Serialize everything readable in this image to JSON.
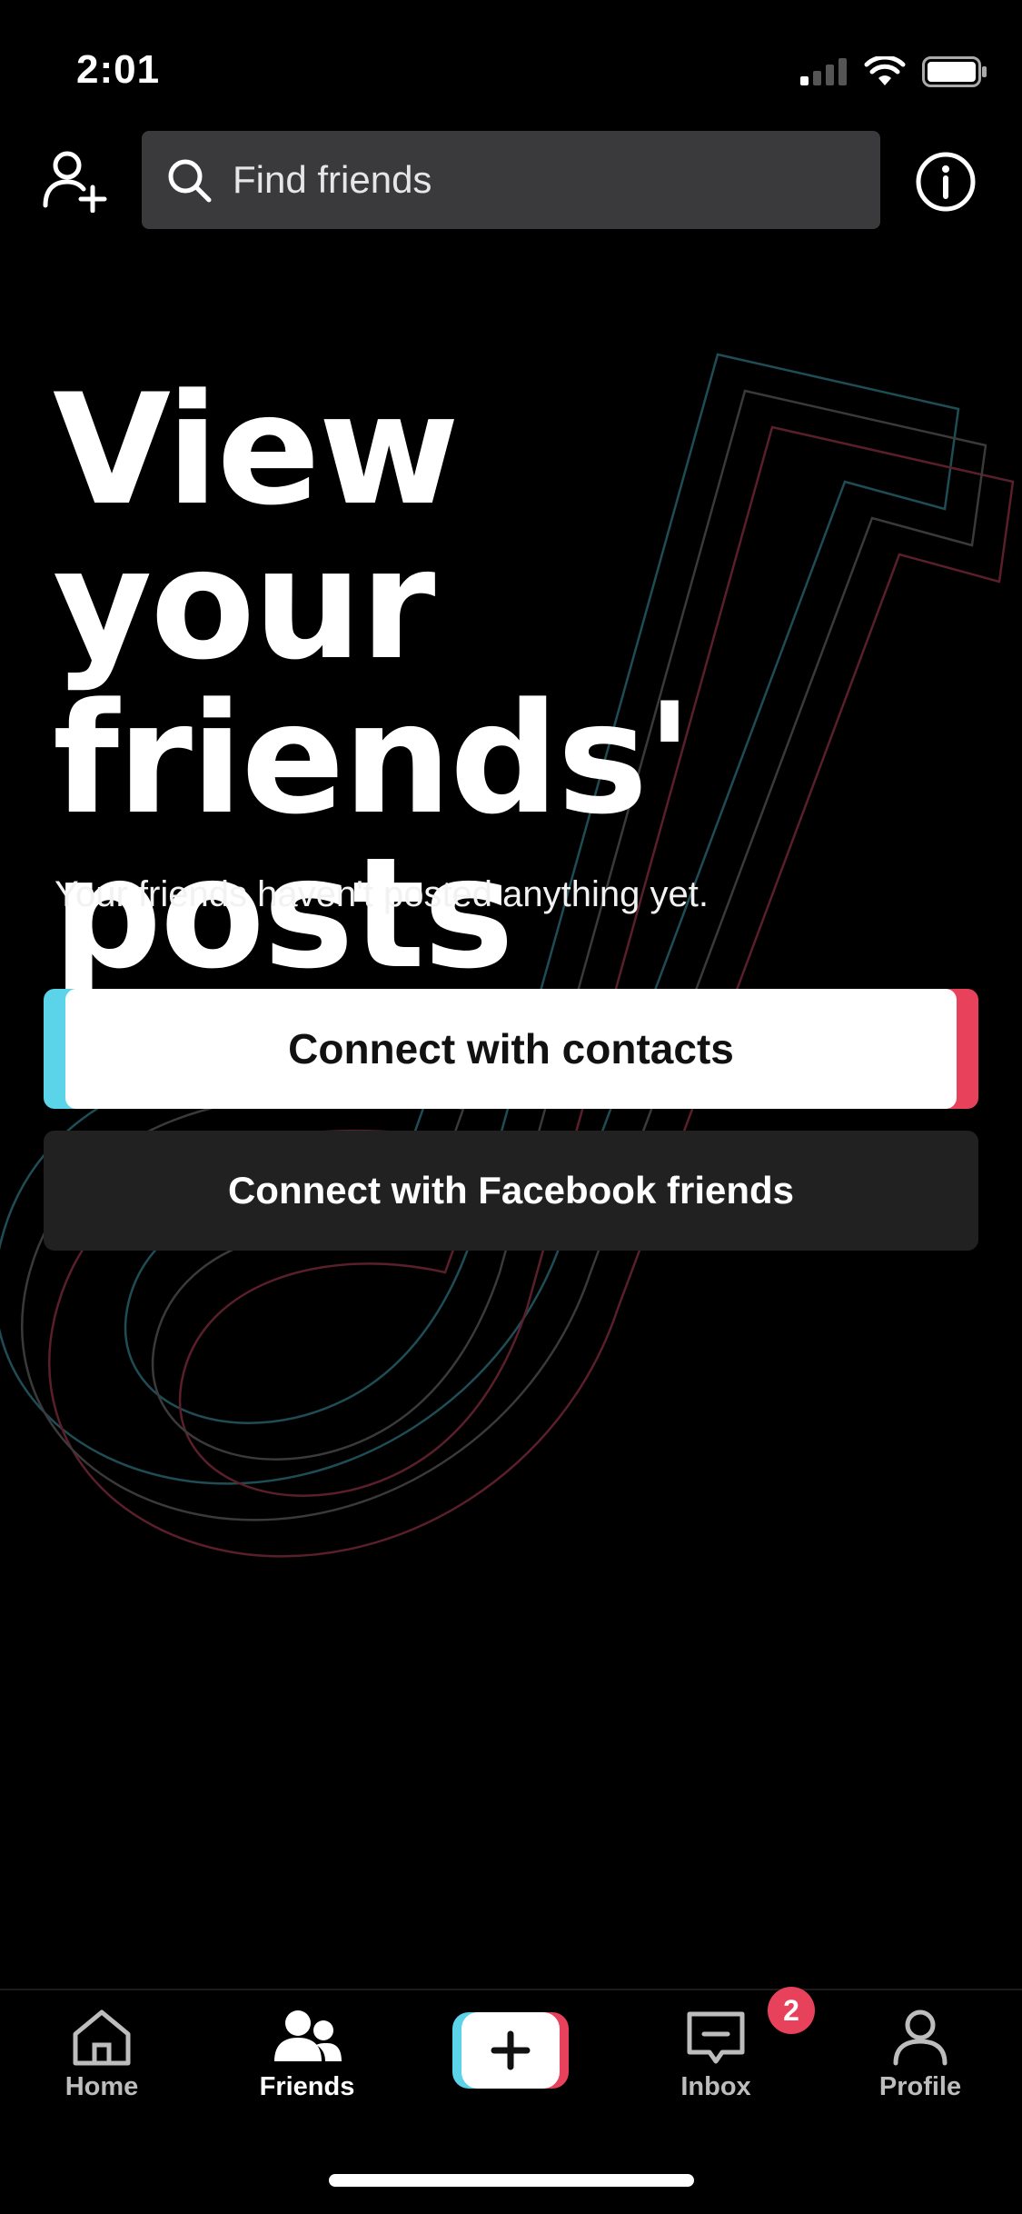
{
  "status_bar": {
    "time": "2:01"
  },
  "search": {
    "placeholder": "Find friends"
  },
  "hero": {
    "title_line1": "View",
    "title_line2": "your friends'",
    "title_line3": "posts",
    "subtitle": "Your friends haven't posted anything yet."
  },
  "actions": {
    "contacts_label": "Connect with contacts",
    "facebook_label": "Connect with Facebook friends"
  },
  "tabbar": {
    "home": "Home",
    "friends": "Friends",
    "inbox": "Inbox",
    "inbox_badge": "2",
    "profile": "Profile"
  },
  "colors": {
    "accent_cyan": "#5bd3e8",
    "accent_red": "#e8415b",
    "search_bg": "#3a3a3c"
  }
}
